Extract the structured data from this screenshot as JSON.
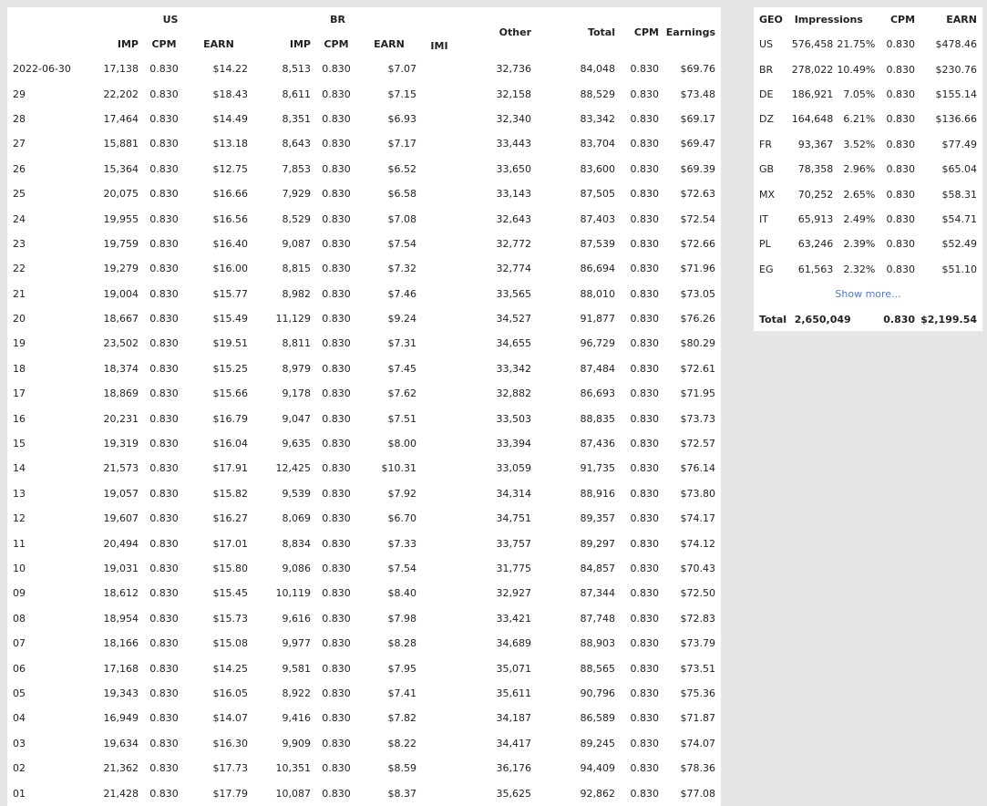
{
  "daily": {
    "groups": {
      "us": "US",
      "br": "BR"
    },
    "headers": {
      "us_imp": "IMP",
      "us_cpm": "CPM",
      "us_earn": "EARN",
      "br_imp": "IMP",
      "br_cpm": "CPM",
      "br_earn": "EARN",
      "imi": "IMI",
      "other": "Other",
      "total": "Total",
      "cpm": "CPM",
      "earnings": "Earnings"
    },
    "rows": [
      {
        "date": "2022-06-30",
        "us_imp": "17,138",
        "us_cpm": "0.830",
        "us_earn": "$14.22",
        "br_imp": "8,513",
        "br_cpm": "0.830",
        "br_earn": "$7.07",
        "imi": "",
        "other": "32,736",
        "total": "84,048",
        "cpm": "0.830",
        "earnings": "$69.76"
      },
      {
        "date": "29",
        "us_imp": "22,202",
        "us_cpm": "0.830",
        "us_earn": "$18.43",
        "br_imp": "8,611",
        "br_cpm": "0.830",
        "br_earn": "$7.15",
        "imi": "",
        "other": "32,158",
        "total": "88,529",
        "cpm": "0.830",
        "earnings": "$73.48"
      },
      {
        "date": "28",
        "us_imp": "17,464",
        "us_cpm": "0.830",
        "us_earn": "$14.49",
        "br_imp": "8,351",
        "br_cpm": "0.830",
        "br_earn": "$6.93",
        "imi": "",
        "other": "32,340",
        "total": "83,342",
        "cpm": "0.830",
        "earnings": "$69.17"
      },
      {
        "date": "27",
        "us_imp": "15,881",
        "us_cpm": "0.830",
        "us_earn": "$13.18",
        "br_imp": "8,643",
        "br_cpm": "0.830",
        "br_earn": "$7.17",
        "imi": "",
        "other": "33,443",
        "total": "83,704",
        "cpm": "0.830",
        "earnings": "$69.47"
      },
      {
        "date": "26",
        "us_imp": "15,364",
        "us_cpm": "0.830",
        "us_earn": "$12.75",
        "br_imp": "7,853",
        "br_cpm": "0.830",
        "br_earn": "$6.52",
        "imi": "",
        "other": "33,650",
        "total": "83,600",
        "cpm": "0.830",
        "earnings": "$69.39"
      },
      {
        "date": "25",
        "us_imp": "20,075",
        "us_cpm": "0.830",
        "us_earn": "$16.66",
        "br_imp": "7,929",
        "br_cpm": "0.830",
        "br_earn": "$6.58",
        "imi": "",
        "other": "33,143",
        "total": "87,505",
        "cpm": "0.830",
        "earnings": "$72.63"
      },
      {
        "date": "24",
        "us_imp": "19,955",
        "us_cpm": "0.830",
        "us_earn": "$16.56",
        "br_imp": "8,529",
        "br_cpm": "0.830",
        "br_earn": "$7.08",
        "imi": "",
        "other": "32,643",
        "total": "87,403",
        "cpm": "0.830",
        "earnings": "$72.54"
      },
      {
        "date": "23",
        "us_imp": "19,759",
        "us_cpm": "0.830",
        "us_earn": "$16.40",
        "br_imp": "9,087",
        "br_cpm": "0.830",
        "br_earn": "$7.54",
        "imi": "",
        "other": "32,772",
        "total": "87,539",
        "cpm": "0.830",
        "earnings": "$72.66"
      },
      {
        "date": "22",
        "us_imp": "19,279",
        "us_cpm": "0.830",
        "us_earn": "$16.00",
        "br_imp": "8,815",
        "br_cpm": "0.830",
        "br_earn": "$7.32",
        "imi": "",
        "other": "32,774",
        "total": "86,694",
        "cpm": "0.830",
        "earnings": "$71.96"
      },
      {
        "date": "21",
        "us_imp": "19,004",
        "us_cpm": "0.830",
        "us_earn": "$15.77",
        "br_imp": "8,982",
        "br_cpm": "0.830",
        "br_earn": "$7.46",
        "imi": "",
        "other": "33,565",
        "total": "88,010",
        "cpm": "0.830",
        "earnings": "$73.05"
      },
      {
        "date": "20",
        "us_imp": "18,667",
        "us_cpm": "0.830",
        "us_earn": "$15.49",
        "br_imp": "11,129",
        "br_cpm": "0.830",
        "br_earn": "$9.24",
        "imi": "",
        "other": "34,527",
        "total": "91,877",
        "cpm": "0.830",
        "earnings": "$76.26"
      },
      {
        "date": "19",
        "us_imp": "23,502",
        "us_cpm": "0.830",
        "us_earn": "$19.51",
        "br_imp": "8,811",
        "br_cpm": "0.830",
        "br_earn": "$7.31",
        "imi": "",
        "other": "34,655",
        "total": "96,729",
        "cpm": "0.830",
        "earnings": "$80.29"
      },
      {
        "date": "18",
        "us_imp": "18,374",
        "us_cpm": "0.830",
        "us_earn": "$15.25",
        "br_imp": "8,979",
        "br_cpm": "0.830",
        "br_earn": "$7.45",
        "imi": "",
        "other": "33,342",
        "total": "87,484",
        "cpm": "0.830",
        "earnings": "$72.61"
      },
      {
        "date": "17",
        "us_imp": "18,869",
        "us_cpm": "0.830",
        "us_earn": "$15.66",
        "br_imp": "9,178",
        "br_cpm": "0.830",
        "br_earn": "$7.62",
        "imi": "",
        "other": "32,882",
        "total": "86,693",
        "cpm": "0.830",
        "earnings": "$71.95"
      },
      {
        "date": "16",
        "us_imp": "20,231",
        "us_cpm": "0.830",
        "us_earn": "$16.79",
        "br_imp": "9,047",
        "br_cpm": "0.830",
        "br_earn": "$7.51",
        "imi": "",
        "other": "33,503",
        "total": "88,835",
        "cpm": "0.830",
        "earnings": "$73.73"
      },
      {
        "date": "15",
        "us_imp": "19,319",
        "us_cpm": "0.830",
        "us_earn": "$16.04",
        "br_imp": "9,635",
        "br_cpm": "0.830",
        "br_earn": "$8.00",
        "imi": "",
        "other": "33,394",
        "total": "87,436",
        "cpm": "0.830",
        "earnings": "$72.57"
      },
      {
        "date": "14",
        "us_imp": "21,573",
        "us_cpm": "0.830",
        "us_earn": "$17.91",
        "br_imp": "12,425",
        "br_cpm": "0.830",
        "br_earn": "$10.31",
        "imi": "",
        "other": "33,059",
        "total": "91,735",
        "cpm": "0.830",
        "earnings": "$76.14"
      },
      {
        "date": "13",
        "us_imp": "19,057",
        "us_cpm": "0.830",
        "us_earn": "$15.82",
        "br_imp": "9,539",
        "br_cpm": "0.830",
        "br_earn": "$7.92",
        "imi": "",
        "other": "34,314",
        "total": "88,916",
        "cpm": "0.830",
        "earnings": "$73.80"
      },
      {
        "date": "12",
        "us_imp": "19,607",
        "us_cpm": "0.830",
        "us_earn": "$16.27",
        "br_imp": "8,069",
        "br_cpm": "0.830",
        "br_earn": "$6.70",
        "imi": "",
        "other": "34,751",
        "total": "89,357",
        "cpm": "0.830",
        "earnings": "$74.17"
      },
      {
        "date": "11",
        "us_imp": "20,494",
        "us_cpm": "0.830",
        "us_earn": "$17.01",
        "br_imp": "8,834",
        "br_cpm": "0.830",
        "br_earn": "$7.33",
        "imi": "",
        "other": "33,757",
        "total": "89,297",
        "cpm": "0.830",
        "earnings": "$74.12"
      },
      {
        "date": "10",
        "us_imp": "19,031",
        "us_cpm": "0.830",
        "us_earn": "$15.80",
        "br_imp": "9,086",
        "br_cpm": "0.830",
        "br_earn": "$7.54",
        "imi": "",
        "other": "31,775",
        "total": "84,857",
        "cpm": "0.830",
        "earnings": "$70.43"
      },
      {
        "date": "09",
        "us_imp": "18,612",
        "us_cpm": "0.830",
        "us_earn": "$15.45",
        "br_imp": "10,119",
        "br_cpm": "0.830",
        "br_earn": "$8.40",
        "imi": "",
        "other": "32,927",
        "total": "87,344",
        "cpm": "0.830",
        "earnings": "$72.50"
      },
      {
        "date": "08",
        "us_imp": "18,954",
        "us_cpm": "0.830",
        "us_earn": "$15.73",
        "br_imp": "9,616",
        "br_cpm": "0.830",
        "br_earn": "$7.98",
        "imi": "",
        "other": "33,421",
        "total": "87,748",
        "cpm": "0.830",
        "earnings": "$72.83"
      },
      {
        "date": "07",
        "us_imp": "18,166",
        "us_cpm": "0.830",
        "us_earn": "$15.08",
        "br_imp": "9,977",
        "br_cpm": "0.830",
        "br_earn": "$8.28",
        "imi": "",
        "other": "34,689",
        "total": "88,903",
        "cpm": "0.830",
        "earnings": "$73.79"
      },
      {
        "date": "06",
        "us_imp": "17,168",
        "us_cpm": "0.830",
        "us_earn": "$14.25",
        "br_imp": "9,581",
        "br_cpm": "0.830",
        "br_earn": "$7.95",
        "imi": "",
        "other": "35,071",
        "total": "88,565",
        "cpm": "0.830",
        "earnings": "$73.51"
      },
      {
        "date": "05",
        "us_imp": "19,343",
        "us_cpm": "0.830",
        "us_earn": "$16.05",
        "br_imp": "8,922",
        "br_cpm": "0.830",
        "br_earn": "$7.41",
        "imi": "",
        "other": "35,611",
        "total": "90,796",
        "cpm": "0.830",
        "earnings": "$75.36"
      },
      {
        "date": "04",
        "us_imp": "16,949",
        "us_cpm": "0.830",
        "us_earn": "$14.07",
        "br_imp": "9,416",
        "br_cpm": "0.830",
        "br_earn": "$7.82",
        "imi": "",
        "other": "34,187",
        "total": "86,589",
        "cpm": "0.830",
        "earnings": "$71.87"
      },
      {
        "date": "03",
        "us_imp": "19,634",
        "us_cpm": "0.830",
        "us_earn": "$16.30",
        "br_imp": "9,909",
        "br_cpm": "0.830",
        "br_earn": "$8.22",
        "imi": "",
        "other": "34,417",
        "total": "89,245",
        "cpm": "0.830",
        "earnings": "$74.07"
      },
      {
        "date": "02",
        "us_imp": "21,362",
        "us_cpm": "0.830",
        "us_earn": "$17.73",
        "br_imp": "10,351",
        "br_cpm": "0.830",
        "br_earn": "$8.59",
        "imi": "",
        "other": "36,176",
        "total": "94,409",
        "cpm": "0.830",
        "earnings": "$78.36"
      },
      {
        "date": "01",
        "us_imp": "21,428",
        "us_cpm": "0.830",
        "us_earn": "$17.79",
        "br_imp": "10,087",
        "br_cpm": "0.830",
        "br_earn": "$8.37",
        "imi": "",
        "other": "35,625",
        "total": "92,862",
        "cpm": "0.830",
        "earnings": "$77.08"
      }
    ]
  },
  "geo": {
    "headers": {
      "geo": "GEO",
      "impressions": "Impressions",
      "cpm": "CPM",
      "earn": "EARN"
    },
    "rows": [
      {
        "geo": "US",
        "impressions": "576,458",
        "pct": "21.75%",
        "cpm": "0.830",
        "earn": "$478.46"
      },
      {
        "geo": "BR",
        "impressions": "278,022",
        "pct": "10.49%",
        "cpm": "0.830",
        "earn": "$230.76"
      },
      {
        "geo": "DE",
        "impressions": "186,921",
        "pct": "7.05%",
        "cpm": "0.830",
        "earn": "$155.14"
      },
      {
        "geo": "DZ",
        "impressions": "164,648",
        "pct": "6.21%",
        "cpm": "0.830",
        "earn": "$136.66"
      },
      {
        "geo": "FR",
        "impressions": "93,367",
        "pct": "3.52%",
        "cpm": "0.830",
        "earn": "$77.49"
      },
      {
        "geo": "GB",
        "impressions": "78,358",
        "pct": "2.96%",
        "cpm": "0.830",
        "earn": "$65.04"
      },
      {
        "geo": "MX",
        "impressions": "70,252",
        "pct": "2.65%",
        "cpm": "0.830",
        "earn": "$58.31"
      },
      {
        "geo": "IT",
        "impressions": "65,913",
        "pct": "2.49%",
        "cpm": "0.830",
        "earn": "$54.71"
      },
      {
        "geo": "PL",
        "impressions": "63,246",
        "pct": "2.39%",
        "cpm": "0.830",
        "earn": "$52.49"
      },
      {
        "geo": "EG",
        "impressions": "61,563",
        "pct": "2.32%",
        "cpm": "0.830",
        "earn": "$51.10"
      }
    ],
    "show_more": "Show more...",
    "total": {
      "label": "Total",
      "impressions": "2,650,049",
      "cpm": "0.830",
      "earn": "$2,199.54"
    }
  },
  "colors": {
    "link": "#4a7bd0",
    "panel": "#ffffff",
    "background": "#e6e6e6"
  }
}
